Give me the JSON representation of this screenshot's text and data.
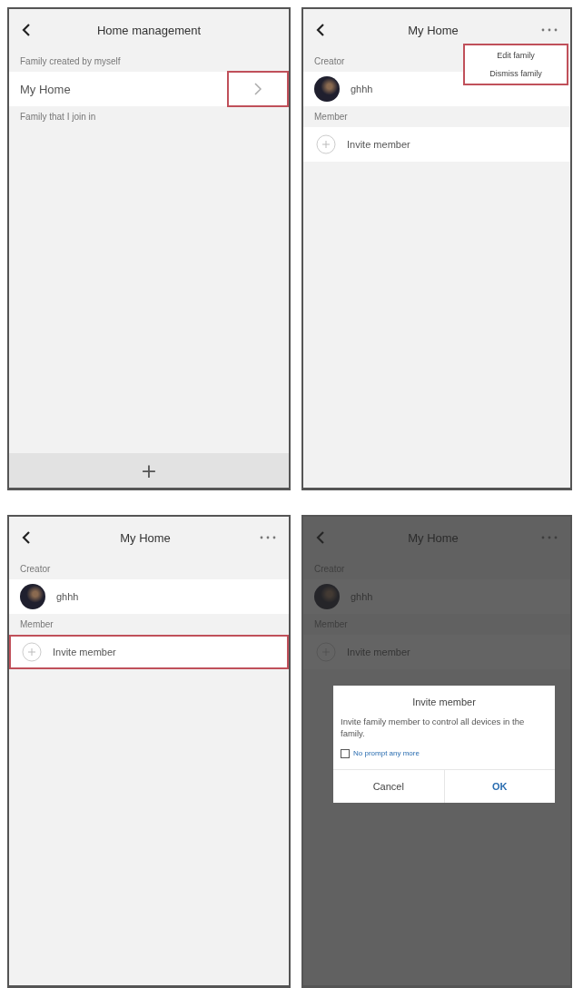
{
  "screens": [
    {
      "kind": "family_list",
      "title": "Home management",
      "created_header": "Family created by myself",
      "family": {
        "name": "My Home",
        "chevron_highlighted": true
      },
      "joined_header": "Family that I join in",
      "add_button": "+"
    },
    {
      "kind": "family_detail",
      "title": "My Home",
      "creator_header": "Creator",
      "creator_name": "ghhh",
      "member_header": "Member",
      "invite": {
        "label": "Invite member",
        "highlighted": false
      },
      "menu": {
        "highlighted": true,
        "items": [
          "Edit family",
          "Dismiss family"
        ]
      },
      "dimmed": false
    },
    {
      "kind": "family_detail",
      "title": "My Home",
      "creator_header": "Creator",
      "creator_name": "ghhh",
      "member_header": "Member",
      "invite": {
        "label": "Invite member",
        "highlighted": true
      },
      "dimmed": false
    },
    {
      "kind": "family_detail",
      "title": "My Home",
      "creator_header": "Creator",
      "creator_name": "ghhh",
      "member_header": "Member",
      "invite": {
        "label": "Invite member",
        "highlighted": false
      },
      "dimmed": true,
      "dialog": {
        "title": "Invite member",
        "message": "Invite family member to control all devices in the family.",
        "checkbox": {
          "label": "No prompt any more",
          "checked": false
        },
        "buttons": [
          "Cancel",
          "OK"
        ]
      }
    }
  ]
}
